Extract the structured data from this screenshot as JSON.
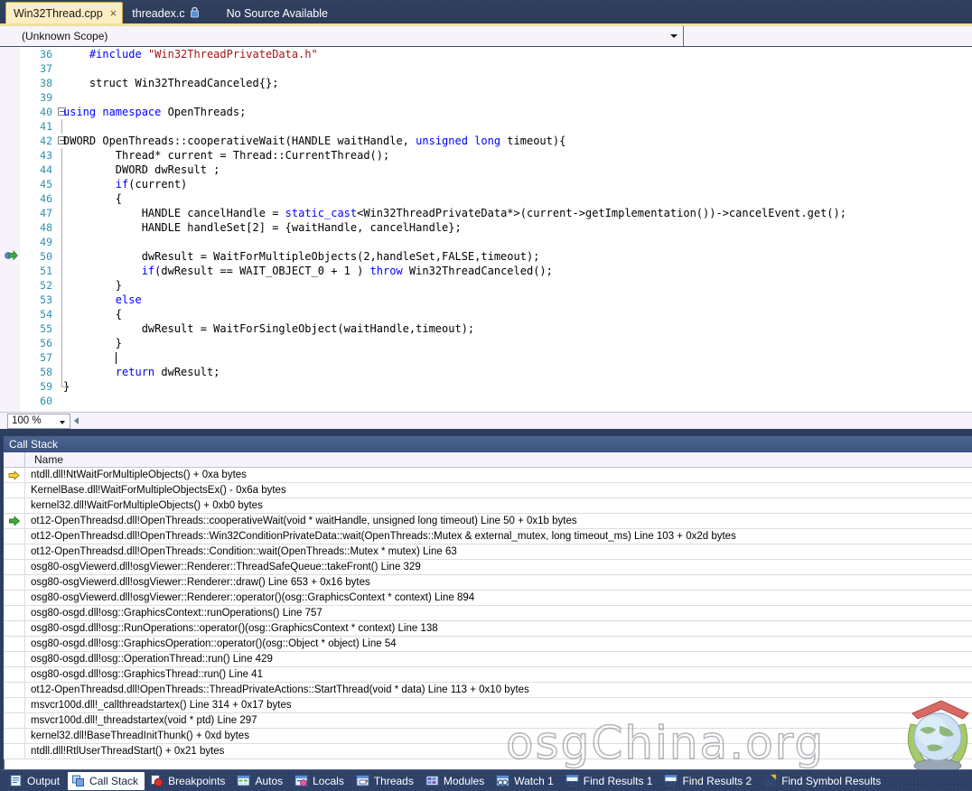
{
  "colors": {
    "chrome_dark": "#2c3e5f",
    "tab_active_bg": "#fbeec3",
    "accent_yellow": "#f0df9e",
    "panel_title_blue": "#46608a",
    "keyword_blue": "#0000ff",
    "string_red": "#a31515",
    "linenumber_teal": "#2b91af",
    "taskbar_bg": "#2e4066"
  },
  "tabbar": {
    "tabs": [
      {
        "label": "Win32Thread.cpp",
        "active": true,
        "close": "×",
        "icon": ""
      },
      {
        "label": "threadex.c",
        "active": false,
        "close": "",
        "icon": "lock-icon"
      }
    ],
    "no_source_label": "No Source Available"
  },
  "navbar": {
    "scope_value": "(Unknown Scope)",
    "member_value": ""
  },
  "editor": {
    "marker_line": 50,
    "caret_line": 57,
    "lines": [
      {
        "num": "36",
        "text": "#include \"Win32ThreadPrivateData.h\"",
        "kind": "include",
        "indent": 1
      },
      {
        "num": "37",
        "text": "",
        "kind": "plain",
        "indent": 0
      },
      {
        "num": "38",
        "text": "struct Win32ThreadCanceled{};",
        "kind": "plain",
        "indent": 1
      },
      {
        "num": "39",
        "text": "",
        "kind": "plain",
        "indent": 0
      },
      {
        "num": "40",
        "text": "using namespace OpenThreads;",
        "kind": "using",
        "indent": 0
      },
      {
        "num": "41",
        "text": "",
        "kind": "plain",
        "indent": 0
      },
      {
        "num": "42",
        "text": "DWORD OpenThreads::cooperativeWait(HANDLE waitHandle, unsigned long timeout){",
        "kind": "funcsig",
        "indent": 0
      },
      {
        "num": "43",
        "text": "Thread* current = Thread::CurrentThread();",
        "kind": "plain",
        "indent": 2
      },
      {
        "num": "44",
        "text": "DWORD dwResult ;",
        "kind": "plain",
        "indent": 2
      },
      {
        "num": "45",
        "text": "if(current)",
        "kind": "if",
        "indent": 2
      },
      {
        "num": "46",
        "text": "{",
        "kind": "plain",
        "indent": 2
      },
      {
        "num": "47",
        "text": "HANDLE cancelHandle = static_cast<Win32ThreadPrivateData*>(current->getImplementation())->cancelEvent.get();",
        "kind": "staticcast",
        "indent": 3
      },
      {
        "num": "48",
        "text": "HANDLE handleSet[2] = {waitHandle, cancelHandle};",
        "kind": "plain",
        "indent": 3
      },
      {
        "num": "49",
        "text": "",
        "kind": "plain",
        "indent": 0
      },
      {
        "num": "50",
        "text": "dwResult = WaitForMultipleObjects(2,handleSet,FALSE,timeout);",
        "kind": "plain",
        "indent": 3
      },
      {
        "num": "51",
        "text": "if(dwResult == WAIT_OBJECT_0 + 1 ) throw Win32ThreadCanceled();",
        "kind": "ifthrow",
        "indent": 3
      },
      {
        "num": "52",
        "text": "}",
        "kind": "plain",
        "indent": 2
      },
      {
        "num": "53",
        "text": "else",
        "kind": "else",
        "indent": 2
      },
      {
        "num": "54",
        "text": "{",
        "kind": "plain",
        "indent": 2
      },
      {
        "num": "55",
        "text": "dwResult = WaitForSingleObject(waitHandle,timeout);",
        "kind": "plain",
        "indent": 3
      },
      {
        "num": "56",
        "text": "}",
        "kind": "plain",
        "indent": 2
      },
      {
        "num": "57",
        "text": "",
        "kind": "plain",
        "indent": 2
      },
      {
        "num": "58",
        "text": "return dwResult;",
        "kind": "return",
        "indent": 2
      },
      {
        "num": "59",
        "text": "}",
        "kind": "plain",
        "indent": 0
      },
      {
        "num": "60",
        "text": "",
        "kind": "plain",
        "indent": 0
      }
    ]
  },
  "zoombar": {
    "zoom_value": "100 %"
  },
  "callstack": {
    "title": "Call Stack",
    "column_name": "Name",
    "rows": [
      {
        "marker": "yellow-arrow",
        "name": "ntdll.dll!NtWaitForMultipleObjects()  + 0xa bytes"
      },
      {
        "marker": "",
        "name": "KernelBase.dll!WaitForMultipleObjectsEx()  - 0x6a bytes"
      },
      {
        "marker": "",
        "name": "kernel32.dll!WaitForMultipleObjects()  + 0xb0 bytes"
      },
      {
        "marker": "green-arrow",
        "name": "ot12-OpenThreadsd.dll!OpenThreads::cooperativeWait(void * waitHandle, unsigned long timeout)  Line 50 + 0x1b bytes"
      },
      {
        "marker": "",
        "name": "ot12-OpenThreadsd.dll!OpenThreads::Win32ConditionPrivateData::wait(OpenThreads::Mutex & external_mutex, long timeout_ms)  Line 103 + 0x2d bytes"
      },
      {
        "marker": "",
        "name": "ot12-OpenThreadsd.dll!OpenThreads::Condition::wait(OpenThreads::Mutex * mutex)  Line 63"
      },
      {
        "marker": "",
        "name": "osg80-osgViewerd.dll!osgViewer::Renderer::ThreadSafeQueue::takeFront()  Line 329"
      },
      {
        "marker": "",
        "name": "osg80-osgViewerd.dll!osgViewer::Renderer::draw()  Line 653 + 0x16 bytes"
      },
      {
        "marker": "",
        "name": "osg80-osgViewerd.dll!osgViewer::Renderer::operator()(osg::GraphicsContext * context)  Line 894"
      },
      {
        "marker": "",
        "name": "osg80-osgd.dll!osg::GraphicsContext::runOperations()  Line 757"
      },
      {
        "marker": "",
        "name": "osg80-osgd.dll!osg::RunOperations::operator()(osg::GraphicsContext * context)  Line 138"
      },
      {
        "marker": "",
        "name": "osg80-osgd.dll!osg::GraphicsOperation::operator()(osg::Object * object)  Line 54"
      },
      {
        "marker": "",
        "name": "osg80-osgd.dll!osg::OperationThread::run()  Line 429"
      },
      {
        "marker": "",
        "name": "osg80-osgd.dll!osg::GraphicsThread::run()  Line 41"
      },
      {
        "marker": "",
        "name": "ot12-OpenThreadsd.dll!OpenThreads::ThreadPrivateActions::StartThread(void * data)  Line 113 + 0x10 bytes"
      },
      {
        "marker": "",
        "name": "msvcr100d.dll!_callthreadstartex()  Line 314 + 0x17 bytes"
      },
      {
        "marker": "",
        "name": "msvcr100d.dll!_threadstartex(void * ptd)  Line 297"
      },
      {
        "marker": "",
        "name": "kernel32.dll!BaseThreadInitThunk()  + 0xd bytes"
      },
      {
        "marker": "",
        "name": "ntdll.dll!RtlUserThreadStart()  + 0x21 bytes"
      }
    ]
  },
  "watermark": {
    "text": "osgChina.org"
  },
  "taskbar": {
    "items": [
      {
        "label": "Output",
        "icon": "output-icon",
        "active": false
      },
      {
        "label": "Call Stack",
        "icon": "callstack-icon",
        "active": true
      },
      {
        "label": "Breakpoints",
        "icon": "breakpoints-icon",
        "active": false
      },
      {
        "label": "Autos",
        "icon": "autos-icon",
        "active": false
      },
      {
        "label": "Locals",
        "icon": "locals-icon",
        "active": false
      },
      {
        "label": "Threads",
        "icon": "threads-icon",
        "active": false
      },
      {
        "label": "Modules",
        "icon": "modules-icon",
        "active": false
      },
      {
        "label": "Watch 1",
        "icon": "watch-icon",
        "active": false
      },
      {
        "label": "Find Results 1",
        "icon": "findresults-icon",
        "active": false
      },
      {
        "label": "Find Results 2",
        "icon": "findresults-icon",
        "active": false
      },
      {
        "label": "Find Symbol Results",
        "icon": "findsymbol-icon",
        "active": false
      }
    ]
  }
}
